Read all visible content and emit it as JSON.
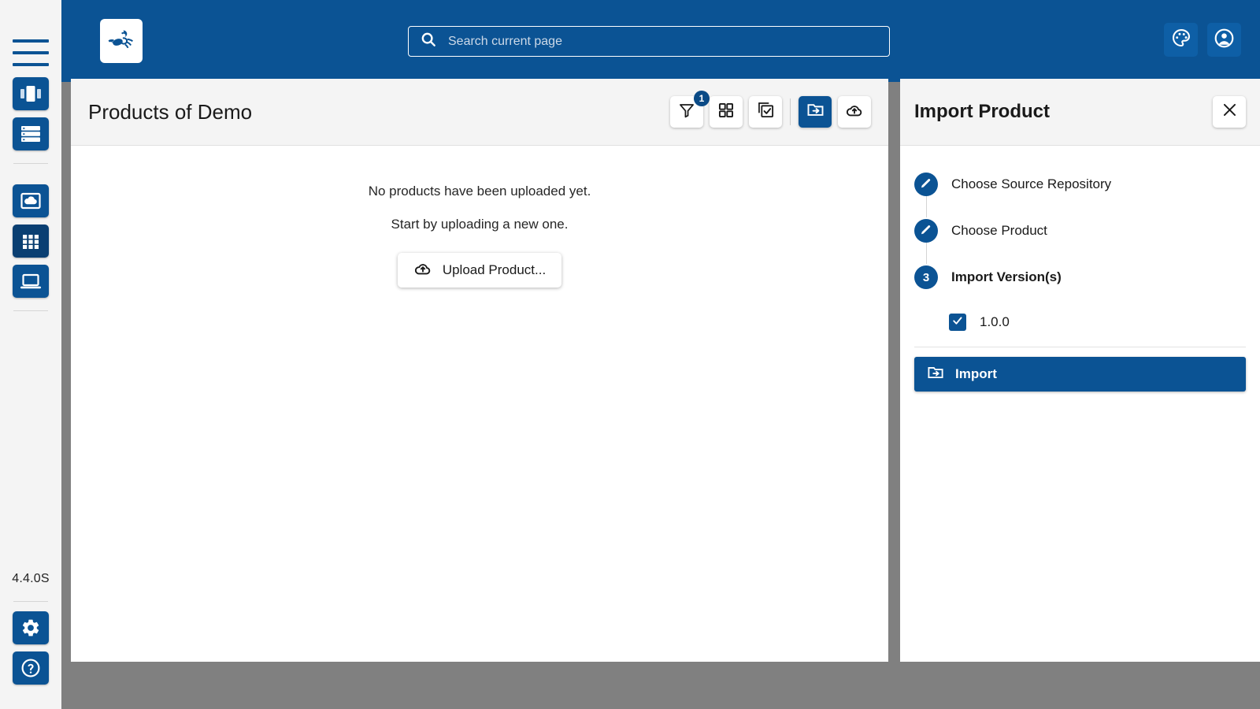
{
  "app": {
    "version": "4.4.0S",
    "logo_icon": "bee-logo-icon"
  },
  "topbar": {
    "search": {
      "placeholder": "Search current page",
      "value": "",
      "icon": "search-icon"
    },
    "actions": [
      {
        "name": "theme-button",
        "icon": "palette-icon"
      },
      {
        "name": "account-button",
        "icon": "user-account-icon"
      }
    ]
  },
  "rail": {
    "menu_icon": "hamburger-menu-icon",
    "groups": [
      {
        "items": [
          {
            "name": "sidebar-item-dashboard",
            "icon": "panels-icon",
            "active": false
          },
          {
            "name": "sidebar-item-servers",
            "icon": "server-list-icon",
            "active": false
          }
        ]
      },
      {
        "items": [
          {
            "name": "sidebar-item-repositories",
            "icon": "cloud-box-icon",
            "active": false
          },
          {
            "name": "sidebar-item-products",
            "icon": "grid-apps-icon",
            "active": true
          },
          {
            "name": "sidebar-item-instances",
            "icon": "laptop-icon",
            "active": false
          }
        ]
      }
    ],
    "bottom": [
      {
        "name": "sidebar-item-settings",
        "icon": "gear-icon"
      },
      {
        "name": "sidebar-item-help",
        "icon": "help-circle-icon"
      }
    ]
  },
  "main": {
    "title": "Products of Demo",
    "toolbar": [
      {
        "name": "filter-button",
        "icon": "filter-icon",
        "badge": "1",
        "active": false
      },
      {
        "name": "tile-view-button",
        "icon": "grid-tiles-icon",
        "badge": null,
        "active": false
      },
      {
        "name": "bulk-select-button",
        "icon": "checkbox-stack-icon",
        "badge": null,
        "active": false
      },
      {
        "name": "import-product-button",
        "icon": "folder-import-icon",
        "badge": null,
        "active": true
      },
      {
        "name": "upload-product-button",
        "icon": "cloud-upload-icon",
        "badge": null,
        "active": false
      }
    ],
    "empty_state": {
      "line1": "No products have been uploaded yet.",
      "line2": "Start by uploading a new one.",
      "button_label": "Upload Product...",
      "button_icon": "cloud-upload-icon"
    }
  },
  "side_panel": {
    "title": "Import Product",
    "close_icon": "close-icon",
    "steps": [
      {
        "marker": "✎",
        "marker_type": "edit",
        "label": "Choose Source Repository",
        "current": false
      },
      {
        "marker": "✎",
        "marker_type": "edit",
        "label": "Choose Product",
        "current": false
      },
      {
        "marker": "3",
        "marker_type": "number",
        "label": "Import Version(s)",
        "current": true
      }
    ],
    "versions": [
      {
        "label": "1.0.0",
        "checked": true
      }
    ],
    "import_button": {
      "label": "Import",
      "icon": "folder-import-icon"
    }
  },
  "colors": {
    "brand_blue": "#0b5394",
    "brand_blue_dark": "#0a3f72",
    "topbar_button": "#0e5fa6",
    "rail_bg": "#f4f4f4",
    "header_bg": "#f4f4f4",
    "backdrop_grey": "#808080",
    "badge_blue": "#0a4a86"
  }
}
